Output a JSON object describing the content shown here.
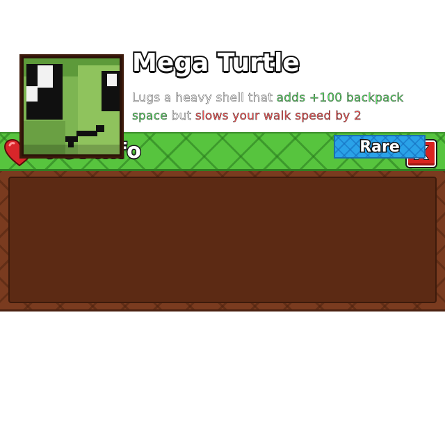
{
  "window": {
    "title": "Pet Info",
    "close_label": "X",
    "icons": {
      "title_icon": "heart-icon",
      "close_icon": "close-icon"
    },
    "colors": {
      "title_bar": "#57c43e",
      "body": "#7a3b1f",
      "close_button": "#d9241f"
    }
  },
  "pet": {
    "name": "Mega Turtle",
    "description": {
      "part1": "Lugs a heavy shell that ",
      "positive": "adds +100 backpack space",
      "part2": " but ",
      "negative": "slows your walk speed by 2"
    },
    "rarity": "Rare",
    "rarity_color": "#2aa2e8",
    "portrait_icon": "turtle-pet-portrait"
  }
}
